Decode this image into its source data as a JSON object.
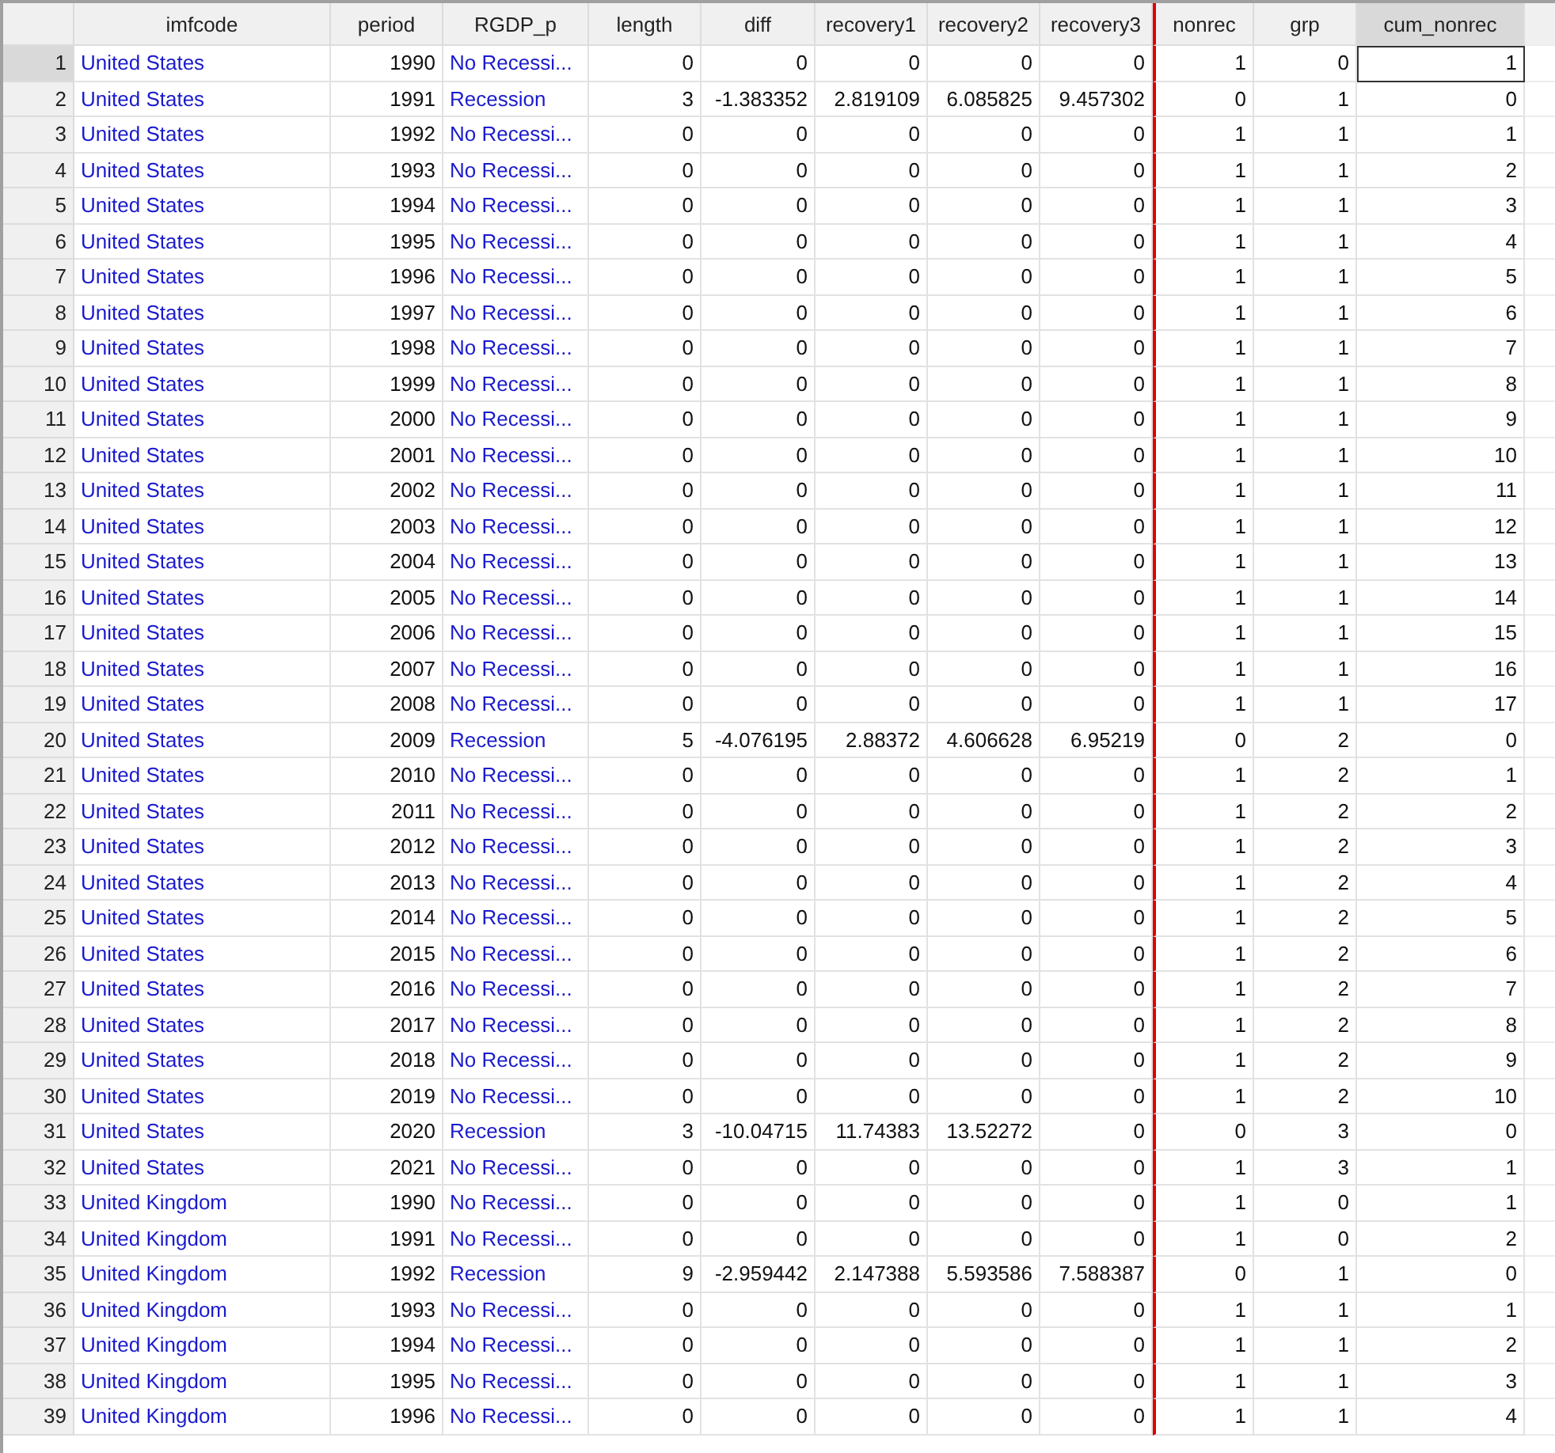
{
  "columns": [
    {
      "label": "imfcode",
      "kind": "text",
      "selected": false
    },
    {
      "label": "period",
      "kind": "number",
      "selected": false
    },
    {
      "label": "RGDP_p",
      "kind": "text",
      "selected": false
    },
    {
      "label": "length",
      "kind": "number",
      "selected": false
    },
    {
      "label": "diff",
      "kind": "number",
      "selected": false
    },
    {
      "label": "recovery1",
      "kind": "number",
      "selected": false
    },
    {
      "label": "recovery2",
      "kind": "number",
      "selected": false
    },
    {
      "label": "recovery3",
      "kind": "number",
      "selected": false
    },
    {
      "label": "nonrec",
      "kind": "number",
      "selected": false
    },
    {
      "label": "grp",
      "kind": "number",
      "selected": false
    },
    {
      "label": "cum_nonrec",
      "kind": "number",
      "selected": true
    }
  ],
  "rows": [
    {
      "n": "1",
      "selected": true,
      "cells": [
        "United States",
        "1990",
        "No Recessi...",
        "0",
        "0",
        "0",
        "0",
        "0",
        "1",
        "0",
        "1"
      ]
    },
    {
      "n": "2",
      "selected": false,
      "cells": [
        "United States",
        "1991",
        "Recession",
        "3",
        "-1.383352",
        "2.819109",
        "6.085825",
        "9.457302",
        "0",
        "1",
        "0"
      ]
    },
    {
      "n": "3",
      "selected": false,
      "cells": [
        "United States",
        "1992",
        "No Recessi...",
        "0",
        "0",
        "0",
        "0",
        "0",
        "1",
        "1",
        "1"
      ]
    },
    {
      "n": "4",
      "selected": false,
      "cells": [
        "United States",
        "1993",
        "No Recessi...",
        "0",
        "0",
        "0",
        "0",
        "0",
        "1",
        "1",
        "2"
      ]
    },
    {
      "n": "5",
      "selected": false,
      "cells": [
        "United States",
        "1994",
        "No Recessi...",
        "0",
        "0",
        "0",
        "0",
        "0",
        "1",
        "1",
        "3"
      ]
    },
    {
      "n": "6",
      "selected": false,
      "cells": [
        "United States",
        "1995",
        "No Recessi...",
        "0",
        "0",
        "0",
        "0",
        "0",
        "1",
        "1",
        "4"
      ]
    },
    {
      "n": "7",
      "selected": false,
      "cells": [
        "United States",
        "1996",
        "No Recessi...",
        "0",
        "0",
        "0",
        "0",
        "0",
        "1",
        "1",
        "5"
      ]
    },
    {
      "n": "8",
      "selected": false,
      "cells": [
        "United States",
        "1997",
        "No Recessi...",
        "0",
        "0",
        "0",
        "0",
        "0",
        "1",
        "1",
        "6"
      ]
    },
    {
      "n": "9",
      "selected": false,
      "cells": [
        "United States",
        "1998",
        "No Recessi...",
        "0",
        "0",
        "0",
        "0",
        "0",
        "1",
        "1",
        "7"
      ]
    },
    {
      "n": "10",
      "selected": false,
      "cells": [
        "United States",
        "1999",
        "No Recessi...",
        "0",
        "0",
        "0",
        "0",
        "0",
        "1",
        "1",
        "8"
      ]
    },
    {
      "n": "11",
      "selected": false,
      "cells": [
        "United States",
        "2000",
        "No Recessi...",
        "0",
        "0",
        "0",
        "0",
        "0",
        "1",
        "1",
        "9"
      ]
    },
    {
      "n": "12",
      "selected": false,
      "cells": [
        "United States",
        "2001",
        "No Recessi...",
        "0",
        "0",
        "0",
        "0",
        "0",
        "1",
        "1",
        "10"
      ]
    },
    {
      "n": "13",
      "selected": false,
      "cells": [
        "United States",
        "2002",
        "No Recessi...",
        "0",
        "0",
        "0",
        "0",
        "0",
        "1",
        "1",
        "11"
      ]
    },
    {
      "n": "14",
      "selected": false,
      "cells": [
        "United States",
        "2003",
        "No Recessi...",
        "0",
        "0",
        "0",
        "0",
        "0",
        "1",
        "1",
        "12"
      ]
    },
    {
      "n": "15",
      "selected": false,
      "cells": [
        "United States",
        "2004",
        "No Recessi...",
        "0",
        "0",
        "0",
        "0",
        "0",
        "1",
        "1",
        "13"
      ]
    },
    {
      "n": "16",
      "selected": false,
      "cells": [
        "United States",
        "2005",
        "No Recessi...",
        "0",
        "0",
        "0",
        "0",
        "0",
        "1",
        "1",
        "14"
      ]
    },
    {
      "n": "17",
      "selected": false,
      "cells": [
        "United States",
        "2006",
        "No Recessi...",
        "0",
        "0",
        "0",
        "0",
        "0",
        "1",
        "1",
        "15"
      ]
    },
    {
      "n": "18",
      "selected": false,
      "cells": [
        "United States",
        "2007",
        "No Recessi...",
        "0",
        "0",
        "0",
        "0",
        "0",
        "1",
        "1",
        "16"
      ]
    },
    {
      "n": "19",
      "selected": false,
      "cells": [
        "United States",
        "2008",
        "No Recessi...",
        "0",
        "0",
        "0",
        "0",
        "0",
        "1",
        "1",
        "17"
      ]
    },
    {
      "n": "20",
      "selected": false,
      "cells": [
        "United States",
        "2009",
        "Recession",
        "5",
        "-4.076195",
        "2.88372",
        "4.606628",
        "6.95219",
        "0",
        "2",
        "0"
      ]
    },
    {
      "n": "21",
      "selected": false,
      "cells": [
        "United States",
        "2010",
        "No Recessi...",
        "0",
        "0",
        "0",
        "0",
        "0",
        "1",
        "2",
        "1"
      ]
    },
    {
      "n": "22",
      "selected": false,
      "cells": [
        "United States",
        "2011",
        "No Recessi...",
        "0",
        "0",
        "0",
        "0",
        "0",
        "1",
        "2",
        "2"
      ]
    },
    {
      "n": "23",
      "selected": false,
      "cells": [
        "United States",
        "2012",
        "No Recessi...",
        "0",
        "0",
        "0",
        "0",
        "0",
        "1",
        "2",
        "3"
      ]
    },
    {
      "n": "24",
      "selected": false,
      "cells": [
        "United States",
        "2013",
        "No Recessi...",
        "0",
        "0",
        "0",
        "0",
        "0",
        "1",
        "2",
        "4"
      ]
    },
    {
      "n": "25",
      "selected": false,
      "cells": [
        "United States",
        "2014",
        "No Recessi...",
        "0",
        "0",
        "0",
        "0",
        "0",
        "1",
        "2",
        "5"
      ]
    },
    {
      "n": "26",
      "selected": false,
      "cells": [
        "United States",
        "2015",
        "No Recessi...",
        "0",
        "0",
        "0",
        "0",
        "0",
        "1",
        "2",
        "6"
      ]
    },
    {
      "n": "27",
      "selected": false,
      "cells": [
        "United States",
        "2016",
        "No Recessi...",
        "0",
        "0",
        "0",
        "0",
        "0",
        "1",
        "2",
        "7"
      ]
    },
    {
      "n": "28",
      "selected": false,
      "cells": [
        "United States",
        "2017",
        "No Recessi...",
        "0",
        "0",
        "0",
        "0",
        "0",
        "1",
        "2",
        "8"
      ]
    },
    {
      "n": "29",
      "selected": false,
      "cells": [
        "United States",
        "2018",
        "No Recessi...",
        "0",
        "0",
        "0",
        "0",
        "0",
        "1",
        "2",
        "9"
      ]
    },
    {
      "n": "30",
      "selected": false,
      "cells": [
        "United States",
        "2019",
        "No Recessi...",
        "0",
        "0",
        "0",
        "0",
        "0",
        "1",
        "2",
        "10"
      ]
    },
    {
      "n": "31",
      "selected": false,
      "cells": [
        "United States",
        "2020",
        "Recession",
        "3",
        "-10.04715",
        "11.74383",
        "13.52272",
        "0",
        "0",
        "3",
        "0"
      ]
    },
    {
      "n": "32",
      "selected": false,
      "cells": [
        "United States",
        "2021",
        "No Recessi...",
        "0",
        "0",
        "0",
        "0",
        "0",
        "1",
        "3",
        "1"
      ]
    },
    {
      "n": "33",
      "selected": false,
      "cells": [
        "United Kingdom",
        "1990",
        "No Recessi...",
        "0",
        "0",
        "0",
        "0",
        "0",
        "1",
        "0",
        "1"
      ]
    },
    {
      "n": "34",
      "selected": false,
      "cells": [
        "United Kingdom",
        "1991",
        "No Recessi...",
        "0",
        "0",
        "0",
        "0",
        "0",
        "1",
        "0",
        "2"
      ]
    },
    {
      "n": "35",
      "selected": false,
      "cells": [
        "United Kingdom",
        "1992",
        "Recession",
        "9",
        "-2.959442",
        "2.147388",
        "5.593586",
        "7.588387",
        "0",
        "1",
        "0"
      ]
    },
    {
      "n": "36",
      "selected": false,
      "cells": [
        "United Kingdom",
        "1993",
        "No Recessi...",
        "0",
        "0",
        "0",
        "0",
        "0",
        "1",
        "1",
        "1"
      ]
    },
    {
      "n": "37",
      "selected": false,
      "cells": [
        "United Kingdom",
        "1994",
        "No Recessi...",
        "0",
        "0",
        "0",
        "0",
        "0",
        "1",
        "1",
        "2"
      ]
    },
    {
      "n": "38",
      "selected": false,
      "cells": [
        "United Kingdom",
        "1995",
        "No Recessi...",
        "0",
        "0",
        "0",
        "0",
        "0",
        "1",
        "1",
        "3"
      ]
    },
    {
      "n": "39",
      "selected": false,
      "cells": [
        "United Kingdom",
        "1996",
        "No Recessi...",
        "0",
        "0",
        "0",
        "0",
        "0",
        "1",
        "1",
        "4"
      ]
    }
  ]
}
